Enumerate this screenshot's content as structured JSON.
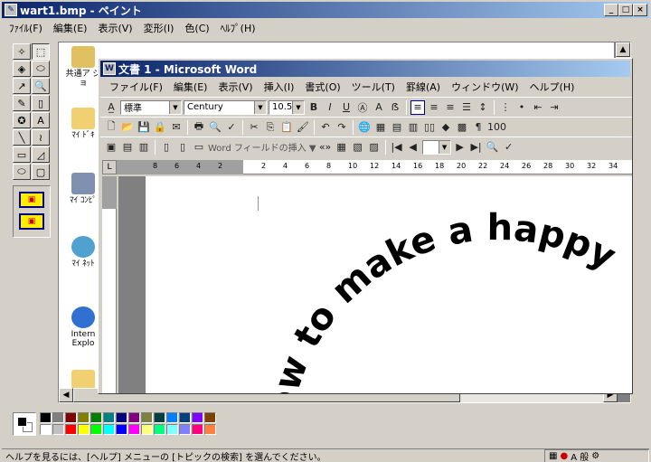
{
  "paint": {
    "title": "wart1.bmp - ペイント",
    "menu": [
      "ﾌｧｲﾙ(F)",
      "編集(E)",
      "表示(V)",
      "変形(I)",
      "色(C)",
      "ﾍﾙﾌﾟ(H)"
    ],
    "tools": [
      "✧",
      "⬚",
      "◈",
      "⬭",
      "↗",
      "🔍",
      "✎",
      "▯",
      "✪",
      "A",
      "╲",
      "≀",
      "▭",
      "◿",
      "⬭",
      "▢"
    ],
    "desktop_icons": [
      {
        "label": "共通ア ジョ"
      },
      {
        "label": "ﾏｲ ﾄﾞｷ"
      },
      {
        "label": "ﾏｲ ｺﾝﾋﾟ"
      },
      {
        "label": "ﾏｲ ﾈｯﾄ"
      },
      {
        "label": "Intern Explo"
      }
    ],
    "palette": [
      "#000000",
      "#808080",
      "#800000",
      "#808000",
      "#008000",
      "#008080",
      "#000080",
      "#800080",
      "#808040",
      "#004040",
      "#0080ff",
      "#004080",
      "#8000ff",
      "#804000",
      "#ffffff",
      "#c0c0c0",
      "#ff0000",
      "#ffff00",
      "#00ff00",
      "#00ffff",
      "#0000ff",
      "#ff00ff",
      "#ffff80",
      "#00ff80",
      "#80ffff",
      "#8080ff",
      "#ff0080",
      "#ff8040"
    ],
    "status": "ヘルプを見るには、[ヘルプ] メニューの [トピックの検索] を選んでください。",
    "tray_text": "A 般"
  },
  "word": {
    "title": "文書 1 - Microsoft Word",
    "menu": [
      "ファイル(F)",
      "編集(E)",
      "表示(V)",
      "挿入(I)",
      "書式(O)",
      "ツール(T)",
      "罫線(A)",
      "ウィンドウ(W)",
      "ヘルプ(H)"
    ],
    "style": "標準",
    "font": "Century",
    "size": "10.5",
    "zoom": "100",
    "field_label": "Word フィールドの挿入 ▼",
    "ruler_numbers": [
      "8",
      "6",
      "4",
      "2",
      "",
      "2",
      "4",
      "6",
      "8",
      "10",
      "12",
      "14",
      "16",
      "18",
      "20",
      "22",
      "24",
      "26",
      "28",
      "30",
      "32",
      "34"
    ],
    "wordart_text": "How to make a happy"
  }
}
